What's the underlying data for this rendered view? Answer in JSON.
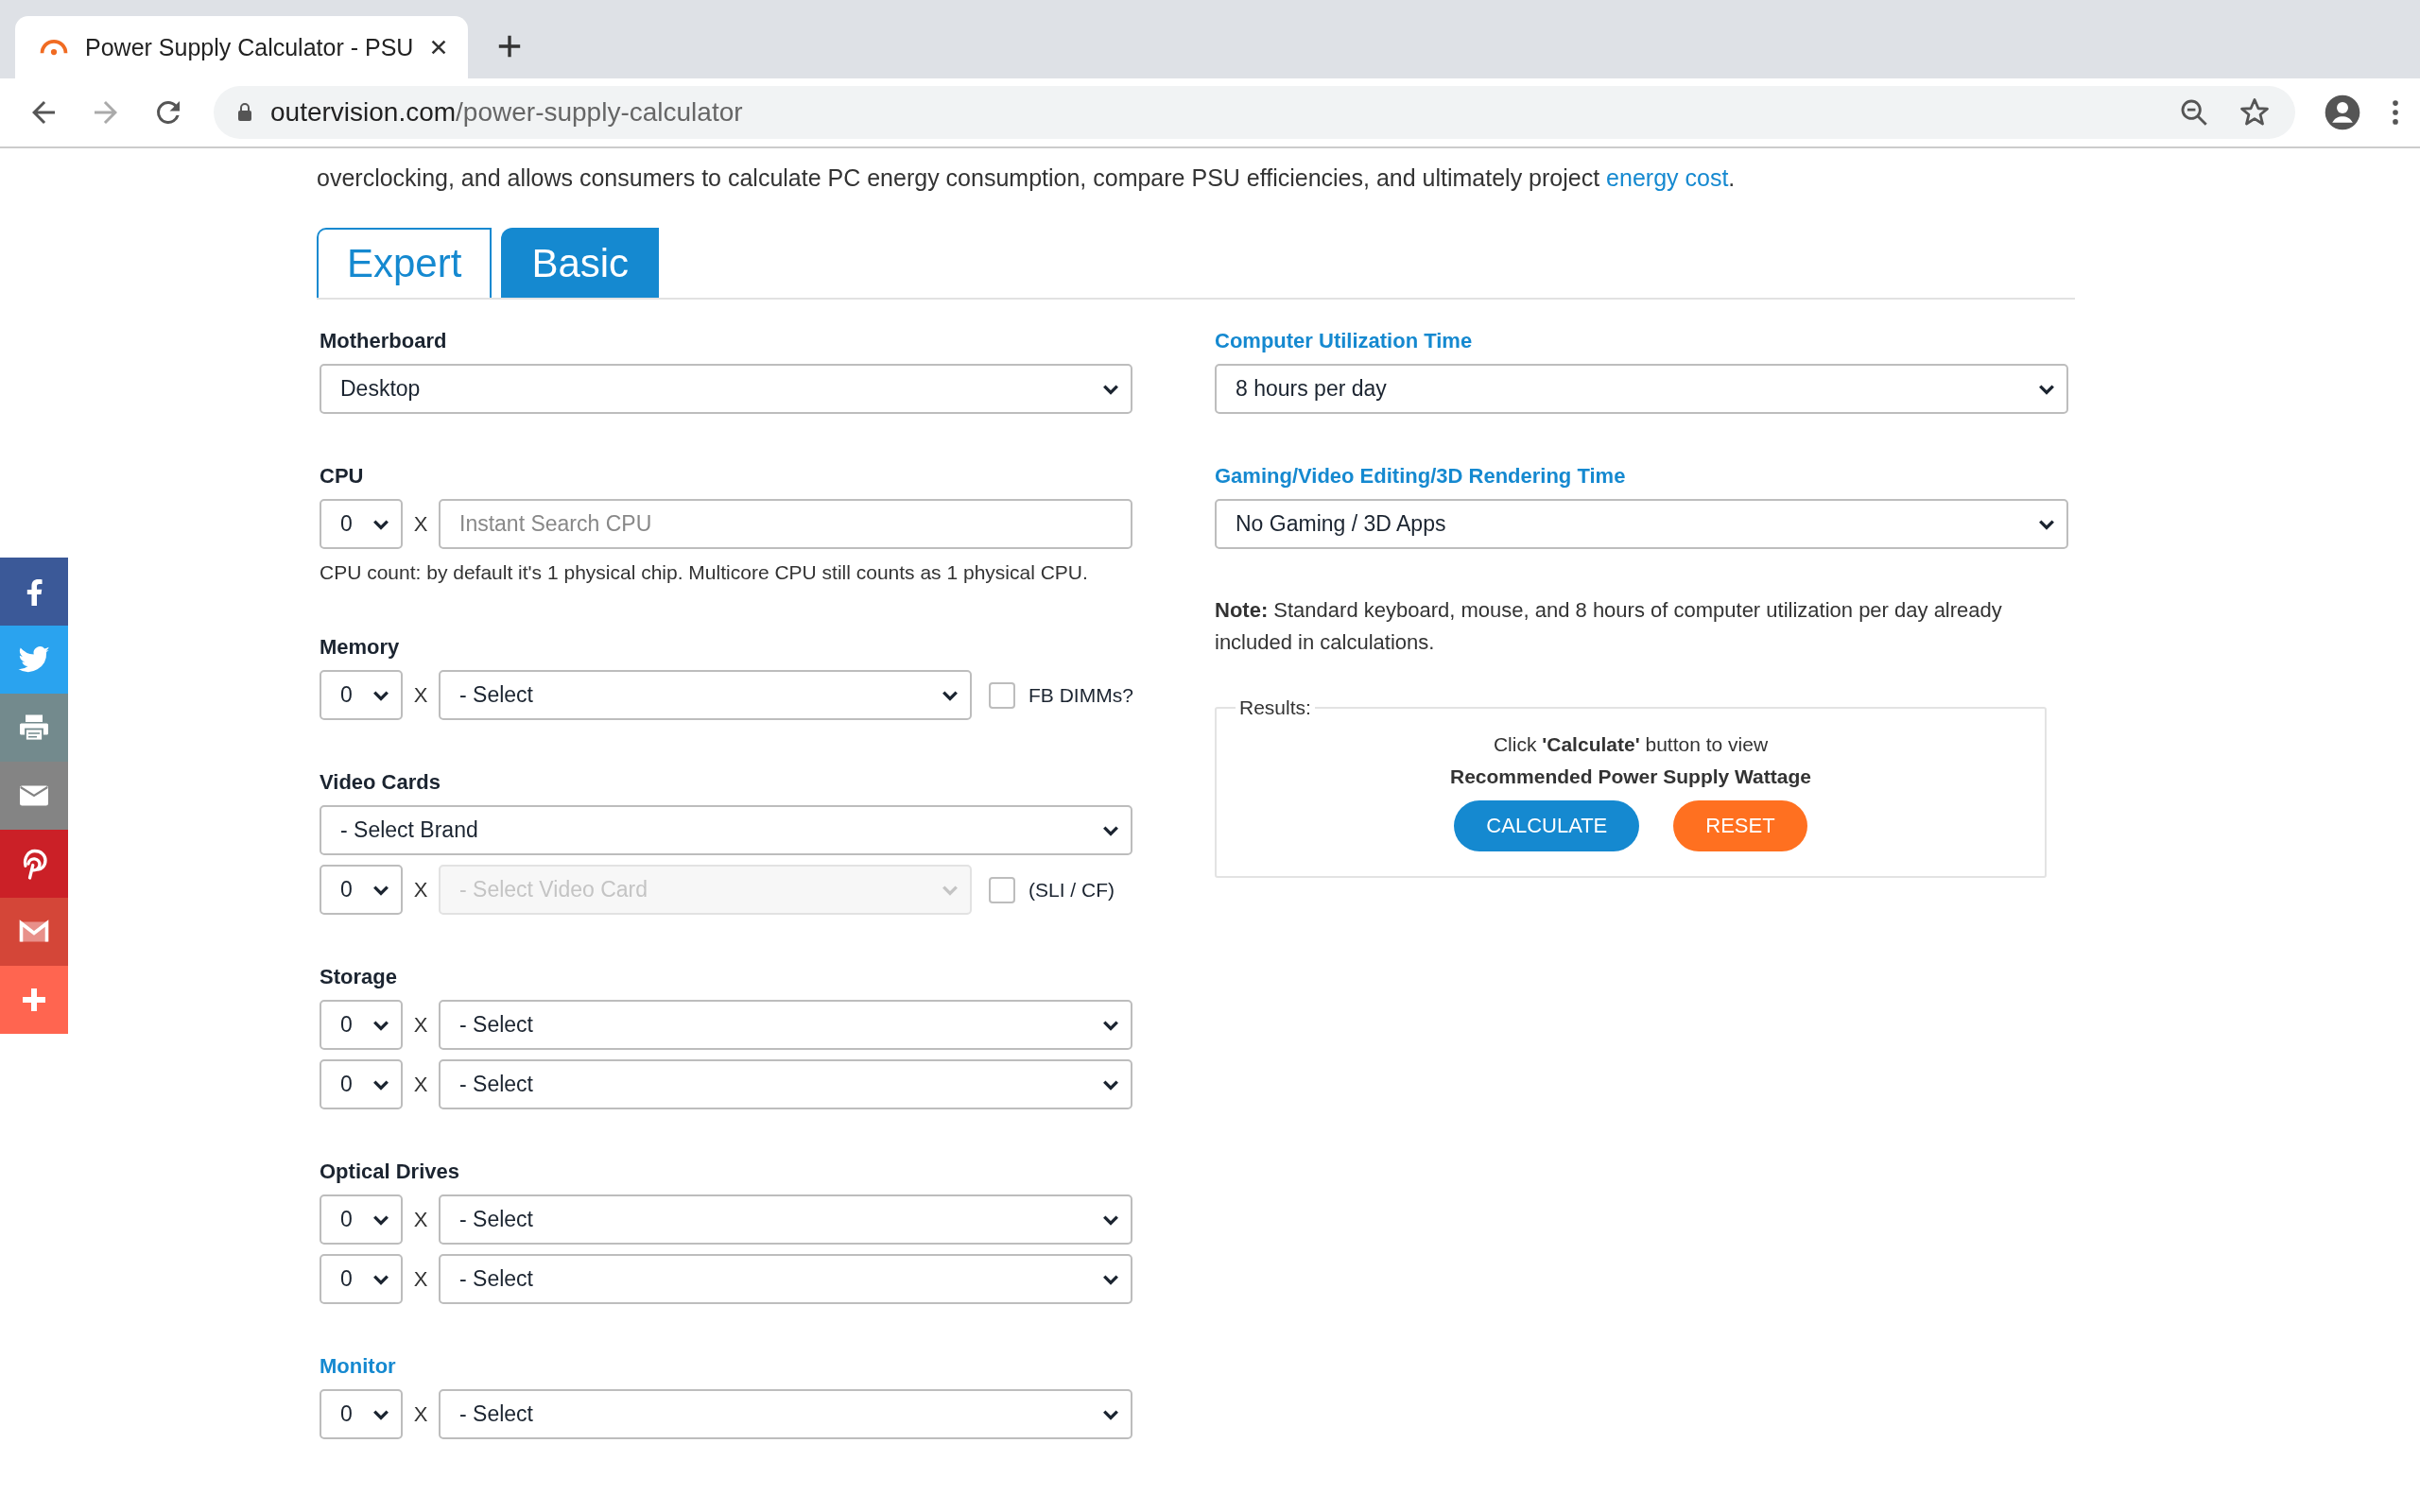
{
  "browser": {
    "tab_title": "Power Supply Calculator - PSU",
    "url_domain": "outervision.com",
    "url_path": "/power-supply-calculator"
  },
  "intro": {
    "text": "overclocking, and allows consumers to calculate PC energy consumption, compare PSU efficiencies, and ultimately project ",
    "link": "energy cost",
    "end": "."
  },
  "tabs": [
    {
      "label": "Expert",
      "selected": false
    },
    {
      "label": "Basic",
      "selected": true
    }
  ],
  "left_sections": [
    {
      "label": "Motherboard",
      "highlighted": false,
      "rows": [
        {
          "kind": "select",
          "value": "Desktop",
          "disabled": false
        }
      ]
    },
    {
      "label": "CPU",
      "highlighted": false,
      "rows": [
        {
          "kind": "qty_search",
          "qty": "0",
          "times": "X",
          "placeholder": "Instant Search CPU"
        }
      ],
      "help": "CPU count: by default it's 1 physical chip. Multicore CPU still counts as 1 physical CPU."
    },
    {
      "label": "Memory",
      "highlighted": false,
      "rows": [
        {
          "kind": "qty_select",
          "qty": "0",
          "times": "X",
          "value": "- Select",
          "disabled": false,
          "checkbox": {
            "label": "FB DIMMs?",
            "checked": false
          }
        }
      ]
    },
    {
      "label": "Video Cards",
      "highlighted": false,
      "rows": [
        {
          "kind": "select",
          "value": "- Select Brand",
          "disabled": false
        },
        {
          "kind": "qty_select",
          "qty": "0",
          "times": "X",
          "value": "- Select Video Card",
          "disabled": true,
          "checkbox": {
            "label": "(SLI / CF)",
            "checked": false
          }
        }
      ]
    },
    {
      "label": "Storage",
      "highlighted": false,
      "rows": [
        {
          "kind": "qty_select",
          "qty": "0",
          "times": "X",
          "value": "- Select",
          "disabled": false
        },
        {
          "kind": "qty_select",
          "qty": "0",
          "times": "X",
          "value": "- Select",
          "disabled": false
        }
      ]
    },
    {
      "label": "Optical Drives",
      "highlighted": false,
      "rows": [
        {
          "kind": "qty_select",
          "qty": "0",
          "times": "X",
          "value": "- Select",
          "disabled": false
        },
        {
          "kind": "qty_select",
          "qty": "0",
          "times": "X",
          "value": "- Select",
          "disabled": false
        }
      ]
    },
    {
      "label": "Monitor",
      "highlighted": true,
      "rows": [
        {
          "kind": "qty_select",
          "qty": "0",
          "times": "X",
          "value": "- Select",
          "disabled": false
        }
      ]
    }
  ],
  "right_sections": [
    {
      "label": "Computer Utilization Time",
      "highlighted": true,
      "value": "8 hours per day"
    },
    {
      "label": "Gaming/Video Editing/3D Rendering Time",
      "highlighted": true,
      "value": "No Gaming / 3D Apps"
    }
  ],
  "note": "**Note:** Standard keyboard, mouse, and 8 hours of computer utilization per day already included in calculations.",
  "results": {
    "legend": "Results:",
    "prompt": "Click **'Calculate'** button to view",
    "headline": "Recommended Power Supply Wattage",
    "buttons": [
      {
        "label": "CALCULATE",
        "kind": "primary"
      },
      {
        "label": "RESET",
        "kind": "reset"
      }
    ]
  },
  "share_bar": [
    {
      "kind": "facebook",
      "color": "#3b5998"
    },
    {
      "kind": "twitter",
      "color": "#2aa3ef"
    },
    {
      "kind": "print",
      "color": "#738a8d"
    },
    {
      "kind": "email",
      "color": "#848484"
    },
    {
      "kind": "pinterest",
      "color": "#cb2027"
    },
    {
      "kind": "gmail",
      "color": "#d44638"
    },
    {
      "kind": "more",
      "color": "#ff6550"
    }
  ]
}
